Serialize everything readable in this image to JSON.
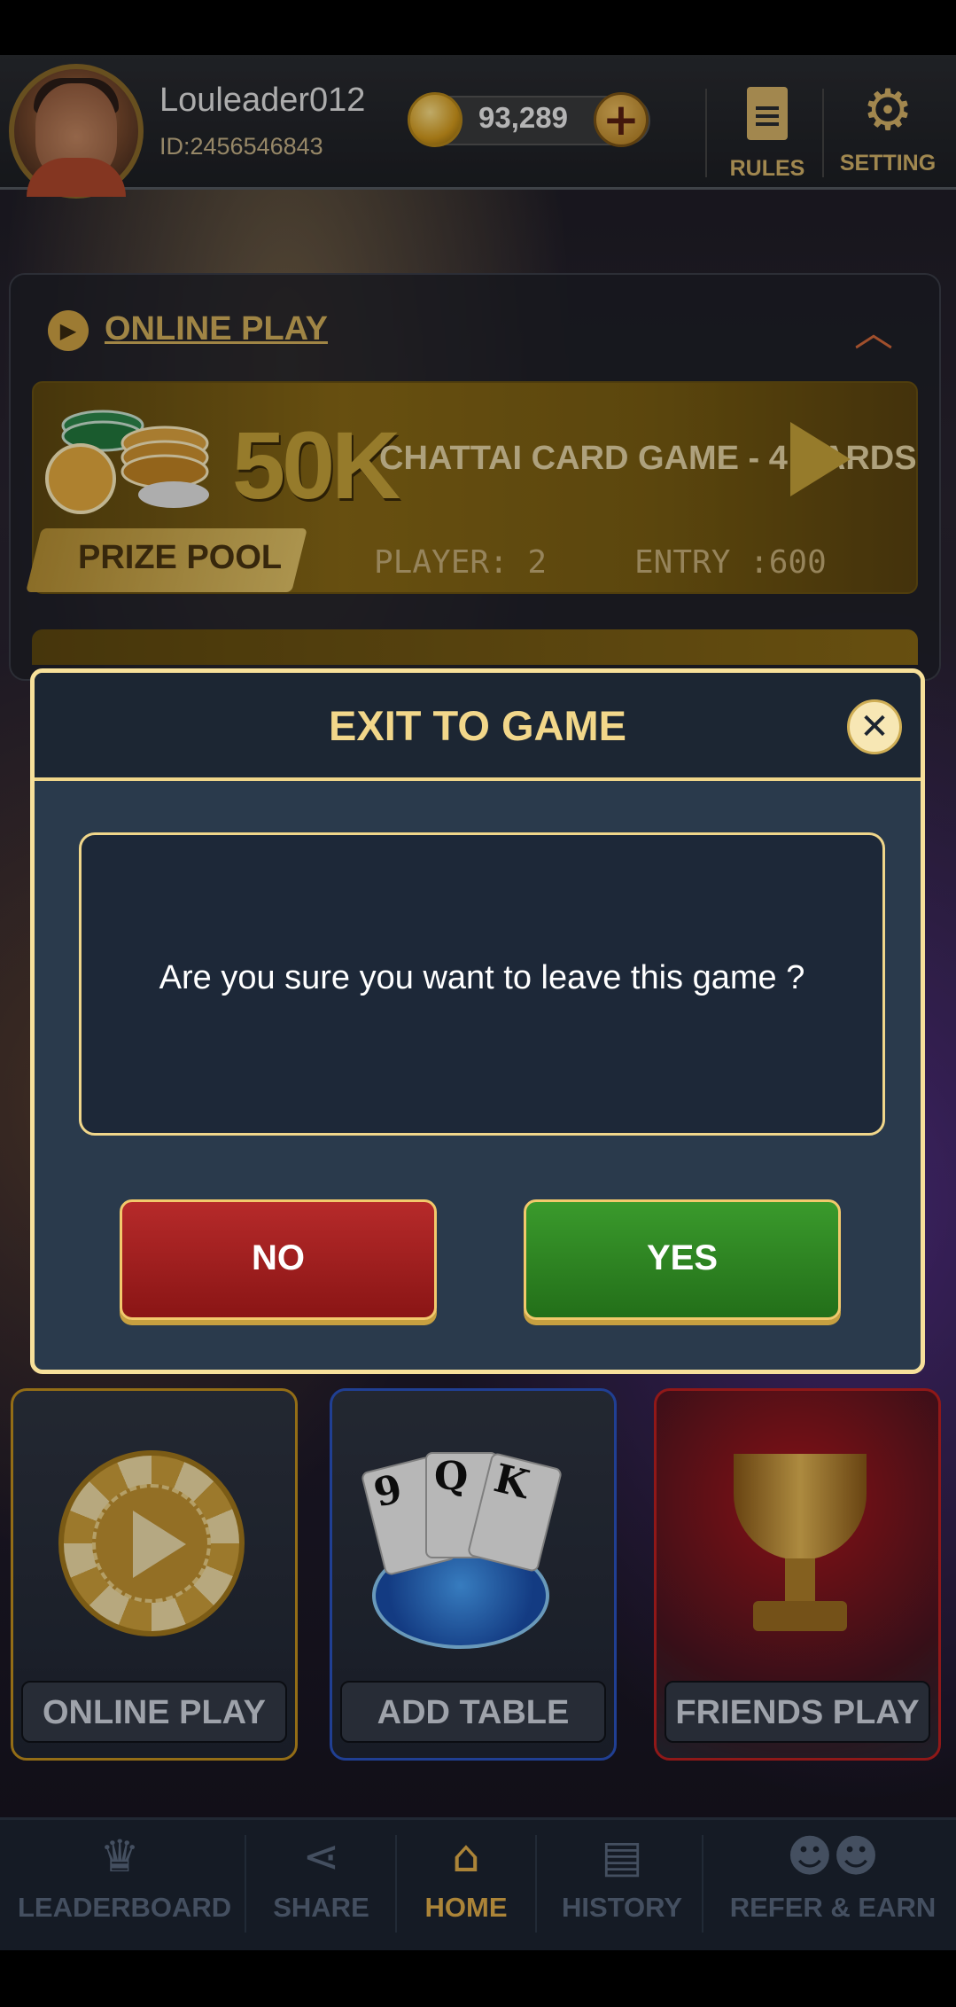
{
  "header": {
    "username": "Louleader012",
    "user_id": "ID:2456546843",
    "coins": "93,289",
    "rules_label": "RULES",
    "setting_label": "SETTING"
  },
  "online_panel": {
    "title": "ONLINE PLAY",
    "game": {
      "prize": "50K",
      "title": "CHATTAI CARD GAME - 4 CARDS",
      "prize_pool_label": "PRIZE POOL",
      "players": "PLAYER: 2",
      "entry": "ENTRY :600"
    }
  },
  "modal": {
    "title": "EXIT TO GAME",
    "message": "Are you sure you want to leave this game ?",
    "no_label": "NO",
    "yes_label": "YES"
  },
  "tiles": [
    {
      "label": "ONLINE PLAY"
    },
    {
      "label": "ADD TABLE"
    },
    {
      "label": "FRIENDS PLAY"
    }
  ],
  "cards": [
    "9",
    "Q",
    "K"
  ],
  "bottom_nav": [
    {
      "label": "LEADERBOARD",
      "icon": "crown-icon"
    },
    {
      "label": "SHARE",
      "icon": "share-icon"
    },
    {
      "label": "HOME",
      "icon": "home-icon",
      "active": true
    },
    {
      "label": "HISTORY",
      "icon": "history-icon"
    },
    {
      "label": "REFER & EARN",
      "icon": "users-icon"
    }
  ],
  "colors": {
    "accent_gold": "#f2d78a",
    "no_red": "#b62a2a",
    "yes_green": "#3a9a2c",
    "modal_bg": "#2a3a4c"
  }
}
